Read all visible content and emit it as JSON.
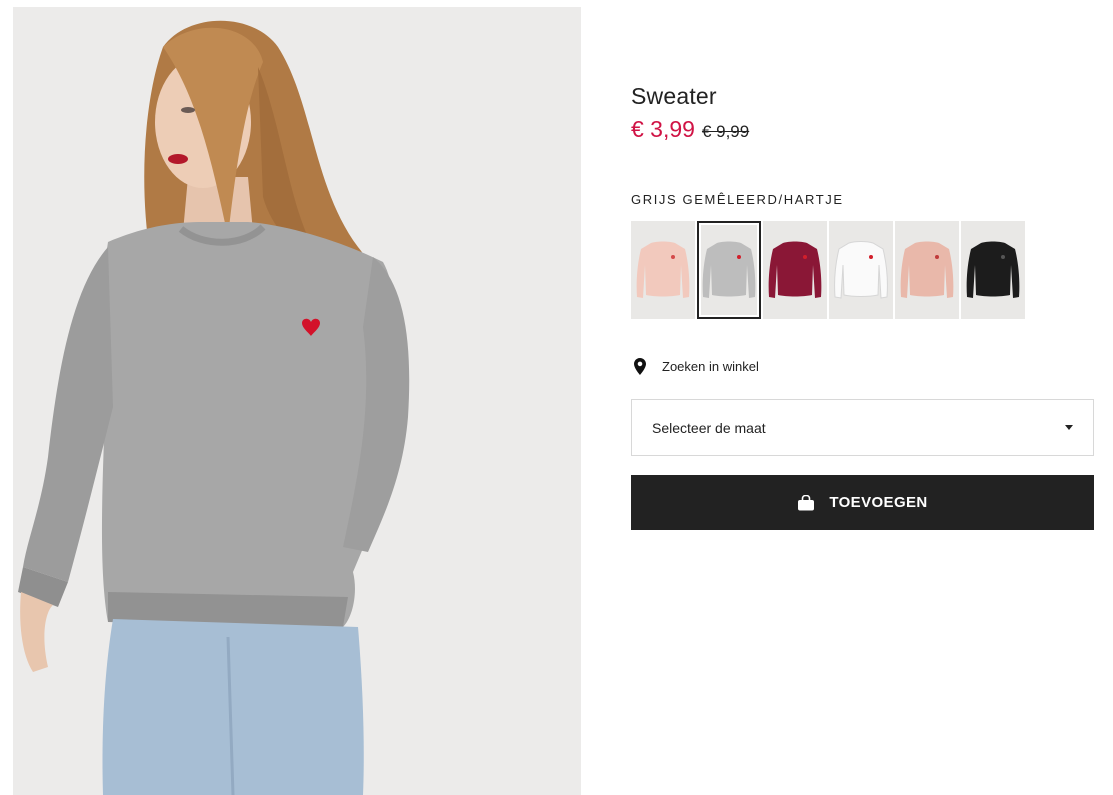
{
  "product": {
    "title": "Sweater",
    "price_current": "€ 3,99",
    "price_original": "€ 9,99",
    "color_label": "GRIJS GEMÊLEERD/HARTJE"
  },
  "swatches": [
    {
      "color": "#f2c9bd",
      "heart": "#d44a4a",
      "selected": false
    },
    {
      "color": "#bdbdbd",
      "heart": "#d21f2b",
      "selected": true
    },
    {
      "color": "#8a1736",
      "heart": "#d21f2b",
      "selected": false
    },
    {
      "color": "#fafafa",
      "heart": "#d21f2b",
      "selected": false
    },
    {
      "color": "#e9b8aa",
      "heart": "#c03a3a",
      "selected": false
    },
    {
      "color": "#1c1c1c",
      "heart": "#555555",
      "selected": false
    }
  ],
  "store": {
    "label": "Zoeken in winkel",
    "icon": "location-pin-icon"
  },
  "size_select": {
    "placeholder": "Selecteer de maat",
    "icon": "caret-down-icon"
  },
  "add_button": {
    "label": "TOEVOEGEN",
    "icon": "shopping-bag-icon"
  },
  "colors": {
    "sale_red": "#d01345",
    "button_black": "#222222",
    "text": "#222222"
  }
}
